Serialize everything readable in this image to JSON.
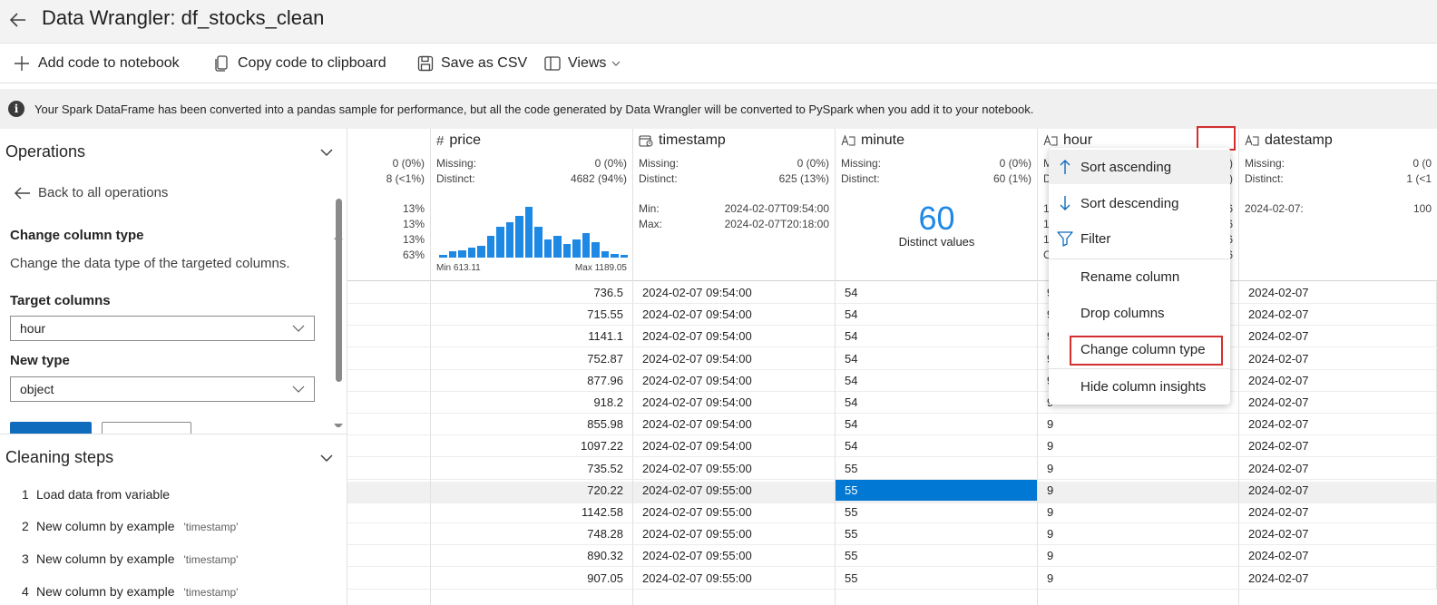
{
  "title": "Data Wrangler: df_stocks_clean",
  "toolbar": {
    "add_code": "Add code to notebook",
    "copy_code": "Copy code to clipboard",
    "save_csv": "Save as CSV",
    "views": "Views"
  },
  "info": "Your Spark DataFrame has been converted into a pandas sample for performance, but all the code generated by Data Wrangler will be converted to PySpark when you add it to your notebook.",
  "operations": {
    "title": "Operations",
    "back": "Back to all operations",
    "heading": "Change column type",
    "description": "Change the data type of the targeted columns.",
    "target_label": "Target columns",
    "target_value": "hour",
    "newtype_label": "New type",
    "newtype_value": "object"
  },
  "cleaning": {
    "title": "Cleaning steps",
    "steps": [
      {
        "num": "1",
        "label": "Load data from variable",
        "arg": ""
      },
      {
        "num": "2",
        "label": "New column by example",
        "arg": "'timestamp'"
      },
      {
        "num": "3",
        "label": "New column by example",
        "arg": "'timestamp'"
      },
      {
        "num": "4",
        "label": "New column by example",
        "arg": "'timestamp'"
      }
    ]
  },
  "columns": {
    "prev": {
      "missing": "0 (0%)",
      "distinct": "8 (<1%)",
      "pcts": [
        "13%",
        "13%",
        "13%",
        "63%"
      ]
    },
    "price": {
      "icon": "#",
      "name": "price",
      "missing_label": "Missing:",
      "missing": "0 (0%)",
      "distinct_label": "Distinct:",
      "distinct": "4682 (94%)",
      "hist_min": "Min 613.11",
      "hist_max": "Max 1189.05",
      "histogram": [
        2,
        5,
        6,
        8,
        9,
        17,
        24,
        28,
        33,
        40,
        24,
        14,
        17,
        11,
        14,
        19,
        12,
        5,
        3,
        2
      ]
    },
    "timestamp": {
      "name": "timestamp",
      "missing_label": "Missing:",
      "missing": "0 (0%)",
      "distinct_label": "Distinct:",
      "distinct": "625 (13%)",
      "min_label": "Min:",
      "min": "2024-02-07T09:54:00",
      "max_label": "Max:",
      "max": "2024-02-07T20:18:00"
    },
    "minute": {
      "name": "minute",
      "missing_label": "Missing:",
      "missing": "0 (0%)",
      "distinct_label": "Distinct:",
      "distinct": "60 (1%)",
      "big_number": "60",
      "big_label": "Distinct values"
    },
    "hour": {
      "name": "hour",
      "stat_fragments": [
        "M",
        "D",
        "1(",
        "1",
        "1",
        "C"
      ],
      "stat_right": [
        ")",
        ")",
        "6",
        "6",
        "6",
        "6"
      ]
    },
    "datestamp": {
      "name": "datestamp",
      "missing_label": "Missing:",
      "missing": "0 (0",
      "distinct_label": "Distinct:",
      "distinct": "1 (<1",
      "top_value": "2024-02-07:",
      "top_pct": "100"
    }
  },
  "rows": [
    {
      "price": "736.5",
      "timestamp": "2024-02-07 09:54:00",
      "minute": "54",
      "hour": "9",
      "datestamp": "2024-02-07"
    },
    {
      "price": "715.55",
      "timestamp": "2024-02-07 09:54:00",
      "minute": "54",
      "hour": "9",
      "datestamp": "2024-02-07"
    },
    {
      "price": "1141.1",
      "timestamp": "2024-02-07 09:54:00",
      "minute": "54",
      "hour": "9",
      "datestamp": "2024-02-07"
    },
    {
      "price": "752.87",
      "timestamp": "2024-02-07 09:54:00",
      "minute": "54",
      "hour": "9",
      "datestamp": "2024-02-07"
    },
    {
      "price": "877.96",
      "timestamp": "2024-02-07 09:54:00",
      "minute": "54",
      "hour": "9",
      "datestamp": "2024-02-07"
    },
    {
      "price": "918.2",
      "timestamp": "2024-02-07 09:54:00",
      "minute": "54",
      "hour": "9",
      "datestamp": "2024-02-07"
    },
    {
      "price": "855.98",
      "timestamp": "2024-02-07 09:54:00",
      "minute": "54",
      "hour": "9",
      "datestamp": "2024-02-07"
    },
    {
      "price": "1097.22",
      "timestamp": "2024-02-07 09:54:00",
      "minute": "54",
      "hour": "9",
      "datestamp": "2024-02-07"
    },
    {
      "price": "735.52",
      "timestamp": "2024-02-07 09:55:00",
      "minute": "55",
      "hour": "9",
      "datestamp": "2024-02-07"
    },
    {
      "price": "720.22",
      "timestamp": "2024-02-07 09:55:00",
      "minute": "55",
      "hour": "9",
      "datestamp": "2024-02-07"
    },
    {
      "price": "1142.58",
      "timestamp": "2024-02-07 09:55:00",
      "minute": "55",
      "hour": "9",
      "datestamp": "2024-02-07"
    },
    {
      "price": "748.28",
      "timestamp": "2024-02-07 09:55:00",
      "minute": "55",
      "hour": "9",
      "datestamp": "2024-02-07"
    },
    {
      "price": "890.32",
      "timestamp": "2024-02-07 09:55:00",
      "minute": "55",
      "hour": "9",
      "datestamp": "2024-02-07"
    },
    {
      "price": "907.05",
      "timestamp": "2024-02-07 09:55:00",
      "minute": "55",
      "hour": "9",
      "datestamp": "2024-02-07"
    }
  ],
  "menu": {
    "sort_asc": "Sort ascending",
    "sort_desc": "Sort descending",
    "filter": "Filter",
    "rename": "Rename column",
    "drop": "Drop columns",
    "change_type": "Change column type",
    "hide_insights": "Hide column insights"
  },
  "colors": {
    "accent": "#1e88e5",
    "selected_cell": "#0078d4",
    "highlight_box": "#d32f2f"
  }
}
